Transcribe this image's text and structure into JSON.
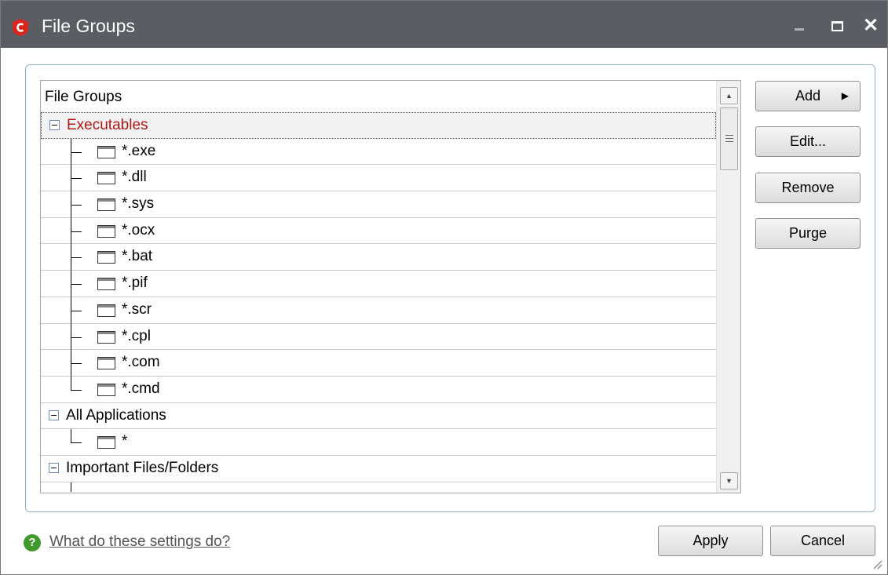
{
  "window": {
    "title": "File Groups",
    "controls": {
      "minimize": "–",
      "maximize": "□",
      "close": "✕"
    },
    "icon": "comodo-logo-icon"
  },
  "tree": {
    "header": "File Groups",
    "groups": [
      {
        "label": "Executables",
        "expanded": true,
        "selected": true,
        "items": [
          "*.exe",
          "*.dll",
          "*.sys",
          "*.ocx",
          "*.bat",
          "*.pif",
          "*.scr",
          "*.cpl",
          "*.com",
          "*.cmd"
        ]
      },
      {
        "label": "All Applications",
        "expanded": true,
        "selected": false,
        "items": [
          "*"
        ]
      },
      {
        "label": "Important Files/Folders",
        "expanded": true,
        "selected": false,
        "items": []
      }
    ]
  },
  "buttons": {
    "add": "Add",
    "edit": "Edit...",
    "remove": "Remove",
    "purge": "Purge",
    "apply": "Apply",
    "cancel": "Cancel"
  },
  "help": {
    "link_text": "What do these settings do?",
    "icon_glyph": "?"
  },
  "colors": {
    "titlebar": "#5a5e64",
    "selected_group_text": "#b01818",
    "help_icon": "#3f9a2b"
  }
}
